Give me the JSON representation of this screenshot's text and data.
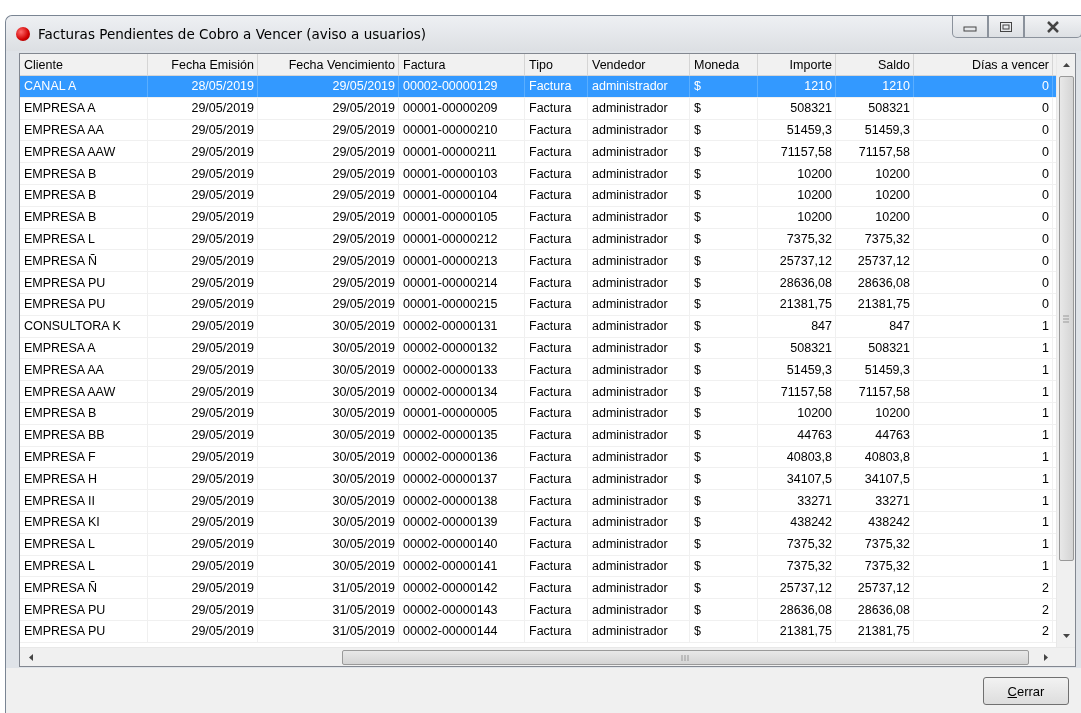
{
  "window": {
    "title": "Facturas Pendientes de Cobro a Vencer (aviso a usuarios)"
  },
  "table": {
    "columns": [
      {
        "label": "Cliente"
      },
      {
        "label": "Fecha Emisión"
      },
      {
        "label": "Fecha Vencimiento"
      },
      {
        "label": "Factura"
      },
      {
        "label": "Tipo"
      },
      {
        "label": "Vendedor"
      },
      {
        "label": "Moneda"
      },
      {
        "label": "Importe"
      },
      {
        "label": "Saldo"
      },
      {
        "label": "Días a vencer"
      }
    ],
    "rows": [
      {
        "selected": true,
        "cells": [
          "CANAL A",
          "28/05/2019",
          "29/05/2019",
          "00002-00000129",
          "Factura",
          "administrador",
          "$",
          "1210",
          "1210",
          "0"
        ]
      },
      {
        "selected": false,
        "cells": [
          "EMPRESA A",
          "29/05/2019",
          "29/05/2019",
          "00001-00000209",
          "Factura",
          "administrador",
          "$",
          "508321",
          "508321",
          "0"
        ]
      },
      {
        "selected": false,
        "cells": [
          "EMPRESA AA",
          "29/05/2019",
          "29/05/2019",
          "00001-00000210",
          "Factura",
          "administrador",
          "$",
          "51459,3",
          "51459,3",
          "0"
        ]
      },
      {
        "selected": false,
        "cells": [
          "EMPRESA AAW",
          "29/05/2019",
          "29/05/2019",
          "00001-00000211",
          "Factura",
          "administrador",
          "$",
          "71157,58",
          "71157,58",
          "0"
        ]
      },
      {
        "selected": false,
        "cells": [
          "EMPRESA B",
          "29/05/2019",
          "29/05/2019",
          "00001-00000103",
          "Factura",
          "administrador",
          "$",
          "10200",
          "10200",
          "0"
        ]
      },
      {
        "selected": false,
        "cells": [
          "EMPRESA B",
          "29/05/2019",
          "29/05/2019",
          "00001-00000104",
          "Factura",
          "administrador",
          "$",
          "10200",
          "10200",
          "0"
        ]
      },
      {
        "selected": false,
        "cells": [
          "EMPRESA B",
          "29/05/2019",
          "29/05/2019",
          "00001-00000105",
          "Factura",
          "administrador",
          "$",
          "10200",
          "10200",
          "0"
        ]
      },
      {
        "selected": false,
        "cells": [
          "EMPRESA L",
          "29/05/2019",
          "29/05/2019",
          "00001-00000212",
          "Factura",
          "administrador",
          "$",
          "7375,32",
          "7375,32",
          "0"
        ]
      },
      {
        "selected": false,
        "cells": [
          "EMPRESA Ñ",
          "29/05/2019",
          "29/05/2019",
          "00001-00000213",
          "Factura",
          "administrador",
          "$",
          "25737,12",
          "25737,12",
          "0"
        ]
      },
      {
        "selected": false,
        "cells": [
          "EMPRESA PU",
          "29/05/2019",
          "29/05/2019",
          "00001-00000214",
          "Factura",
          "administrador",
          "$",
          "28636,08",
          "28636,08",
          "0"
        ]
      },
      {
        "selected": false,
        "cells": [
          "EMPRESA PU",
          "29/05/2019",
          "29/05/2019",
          "00001-00000215",
          "Factura",
          "administrador",
          "$",
          "21381,75",
          "21381,75",
          "0"
        ]
      },
      {
        "selected": false,
        "cells": [
          "CONSULTORA K",
          "29/05/2019",
          "30/05/2019",
          "00002-00000131",
          "Factura",
          "administrador",
          "$",
          "847",
          "847",
          "1"
        ]
      },
      {
        "selected": false,
        "cells": [
          "EMPRESA A",
          "29/05/2019",
          "30/05/2019",
          "00002-00000132",
          "Factura",
          "administrador",
          "$",
          "508321",
          "508321",
          "1"
        ]
      },
      {
        "selected": false,
        "cells": [
          "EMPRESA AA",
          "29/05/2019",
          "30/05/2019",
          "00002-00000133",
          "Factura",
          "administrador",
          "$",
          "51459,3",
          "51459,3",
          "1"
        ]
      },
      {
        "selected": false,
        "cells": [
          "EMPRESA AAW",
          "29/05/2019",
          "30/05/2019",
          "00002-00000134",
          "Factura",
          "administrador",
          "$",
          "71157,58",
          "71157,58",
          "1"
        ]
      },
      {
        "selected": false,
        "cells": [
          "EMPRESA B",
          "29/05/2019",
          "30/05/2019",
          "00001-00000005",
          "Factura",
          "administrador",
          "$",
          "10200",
          "10200",
          "1"
        ]
      },
      {
        "selected": false,
        "cells": [
          "EMPRESA BB",
          "29/05/2019",
          "30/05/2019",
          "00002-00000135",
          "Factura",
          "administrador",
          "$",
          "44763",
          "44763",
          "1"
        ]
      },
      {
        "selected": false,
        "cells": [
          "EMPRESA F",
          "29/05/2019",
          "30/05/2019",
          "00002-00000136",
          "Factura",
          "administrador",
          "$",
          "40803,8",
          "40803,8",
          "1"
        ]
      },
      {
        "selected": false,
        "cells": [
          "EMPRESA H",
          "29/05/2019",
          "30/05/2019",
          "00002-00000137",
          "Factura",
          "administrador",
          "$",
          "34107,5",
          "34107,5",
          "1"
        ]
      },
      {
        "selected": false,
        "cells": [
          "EMPRESA II",
          "29/05/2019",
          "30/05/2019",
          "00002-00000138",
          "Factura",
          "administrador",
          "$",
          "33271",
          "33271",
          "1"
        ]
      },
      {
        "selected": false,
        "cells": [
          "EMPRESA KI",
          "29/05/2019",
          "30/05/2019",
          "00002-00000139",
          "Factura",
          "administrador",
          "$",
          "438242",
          "438242",
          "1"
        ]
      },
      {
        "selected": false,
        "cells": [
          "EMPRESA L",
          "29/05/2019",
          "30/05/2019",
          "00002-00000140",
          "Factura",
          "administrador",
          "$",
          "7375,32",
          "7375,32",
          "1"
        ]
      },
      {
        "selected": false,
        "cells": [
          "EMPRESA L",
          "29/05/2019",
          "30/05/2019",
          "00002-00000141",
          "Factura",
          "administrador",
          "$",
          "7375,32",
          "7375,32",
          "1"
        ]
      },
      {
        "selected": false,
        "cells": [
          "EMPRESA Ñ",
          "29/05/2019",
          "31/05/2019",
          "00002-00000142",
          "Factura",
          "administrador",
          "$",
          "25737,12",
          "25737,12",
          "2"
        ]
      },
      {
        "selected": false,
        "cells": [
          "EMPRESA PU",
          "29/05/2019",
          "31/05/2019",
          "00002-00000143",
          "Factura",
          "administrador",
          "$",
          "28636,08",
          "28636,08",
          "2"
        ]
      },
      {
        "selected": false,
        "cells": [
          "EMPRESA PU",
          "29/05/2019",
          "31/05/2019",
          "00002-00000144",
          "Factura",
          "administrador",
          "$",
          "21381,75",
          "21381,75",
          "2"
        ]
      }
    ]
  },
  "buttons": [
    {
      "label": "Cerrar",
      "mnemonic_underlined": true
    }
  ]
}
